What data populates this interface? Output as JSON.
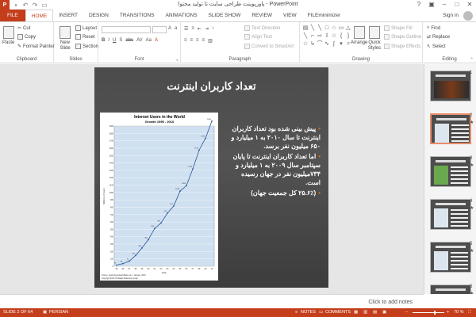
{
  "window": {
    "app_letter": "P",
    "title": "پاورپوینت طراحی سایت تا تولید محتوا - PowerPoint",
    "qat": [
      "save-icon",
      "undo-icon",
      "redo-icon",
      "slideshow-icon"
    ]
  },
  "tabs": [
    "FILE",
    "HOME",
    "INSERT",
    "DESIGN",
    "TRANSITIONS",
    "ANIMATIONS",
    "SLIDE SHOW",
    "REVIEW",
    "VIEW",
    "FILEminimizer"
  ],
  "active_tab": "HOME",
  "signin_label": "Sign in",
  "ribbon": {
    "clipboard": {
      "label": "Clipboard",
      "paste": "Paste",
      "cut": "Cut",
      "copy": "Copy",
      "format_painter": "Format Painter"
    },
    "slides": {
      "label": "Slides",
      "new_slide": "New Slide",
      "layout": "Layout",
      "reset": "Reset",
      "section": "Section"
    },
    "font": {
      "label": "Font"
    },
    "paragraph": {
      "label": "Paragraph",
      "text_direction": "Text Direction",
      "align_text": "Align Text",
      "smartart": "Convert to SmartArt"
    },
    "drawing": {
      "label": "Drawing",
      "arrange": "Arrange",
      "quick_styles": "Quick Styles",
      "shape_fill": "Shape Fill",
      "shape_outline": "Shape Outline",
      "shape_effects": "Shape Effects"
    },
    "editing": {
      "label": "Editing",
      "find": "Find",
      "replace": "Replace",
      "select": "Select"
    }
  },
  "slide": {
    "title": "تعداد کاربران اینترنت",
    "bullets": [
      "پیش بینی شده بود تعداد کاربران اینترنت تا سال ۲۰۱۰ به ۱ میلیارد و ۶۵۰ میلیون نفر برسد.",
      "اما تعداد کاربران اینترنت تا پایان سپتامبر سال ۲۰۰۹ به ۱ میلیارد و ۷۳۴میلیون نفر در جهان رسیده است.",
      "(۲۵.۶٪ کل جمعیت جهان)"
    ],
    "chart_data": {
      "type": "line",
      "title": "Internet Users in the World",
      "subtitle": "Growth 1995 - 2010",
      "ylabel": "Millions of Users",
      "xlabel": "Date",
      "x": [
        "95",
        "96",
        "97",
        "98",
        "99",
        "00",
        "01",
        "02",
        "03",
        "04",
        "05",
        "06",
        "07",
        "08",
        "09",
        "10"
      ],
      "values": [
        16,
        36,
        70,
        147,
        248,
        361,
        513,
        587,
        719,
        817,
        1018,
        1093,
        1319,
        1574,
        1734,
        1966
      ],
      "ylim": [
        0,
        1900
      ],
      "yticks": [
        0,
        100,
        200,
        300,
        400,
        500,
        600,
        700,
        800,
        900,
        1000,
        1100,
        1200,
        1300,
        1400,
        1500,
        1600,
        1700,
        1800,
        1900
      ],
      "grid": true,
      "footnote1": "Source: www.internetworldstats.com - January, 2010",
      "footnote2": "Copyright 2010, Miniwatts Marketing Group"
    }
  },
  "notes_hint": "Click to add notes",
  "thumbnails": [
    {
      "num": "1",
      "star": false
    },
    {
      "num": "2",
      "star": true
    },
    {
      "num": "3",
      "star": true
    },
    {
      "num": "4",
      "star": true
    },
    {
      "num": "5",
      "star": true
    },
    {
      "num": "6",
      "star": true
    }
  ],
  "status": {
    "slide_info": "SLIDE 2 OF 64",
    "language": "PERSIAN",
    "notes": "NOTES",
    "comments": "COMMENTS",
    "zoom": "70 %",
    "zoom_level": 0.7
  },
  "colors": {
    "accent": "#c43e1c",
    "bullet": "#e26a00",
    "line": "#2b5797",
    "chart_bg": "#cfe0f0"
  }
}
